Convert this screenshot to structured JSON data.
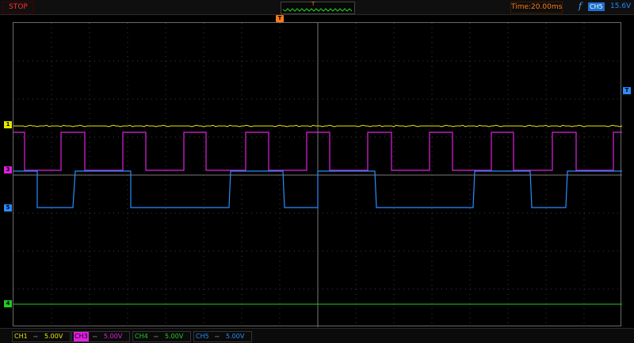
{
  "toolbar": {
    "run_state": "STOP",
    "trigger_preview_marker": "T",
    "timebase": "Time:20.00ms",
    "trigger_icon": "f",
    "trigger_source": "CH5",
    "trigger_level": "15.6V"
  },
  "markers": {
    "trigger_position": "T",
    "trigger_level": "T",
    "ch1": "1",
    "ch3": "3",
    "ch4": "4",
    "ch5": "5"
  },
  "channels": [
    {
      "name": "CH1",
      "coupling": "⎓",
      "scale": "5.00V",
      "color": "#e6e600"
    },
    {
      "name": "CH3",
      "coupling": "⎓",
      "scale": "5.00V",
      "color": "#e020e0"
    },
    {
      "name": "CH4",
      "coupling": "⎓",
      "scale": "5.00V",
      "color": "#22cc22"
    },
    {
      "name": "CH5",
      "coupling": "⎓",
      "scale": "5.00V",
      "color": "#2a8cff"
    }
  ],
  "colors": {
    "ch1": "#e6e600",
    "ch3": "#e020e0",
    "ch4": "#22cc22",
    "ch5": "#2a8cff",
    "grid": "#3c3c3c",
    "accent_orange": "#ff7a1a"
  },
  "icons": [
    "trigger-marker-icon",
    "trigger-function-icon"
  ]
}
